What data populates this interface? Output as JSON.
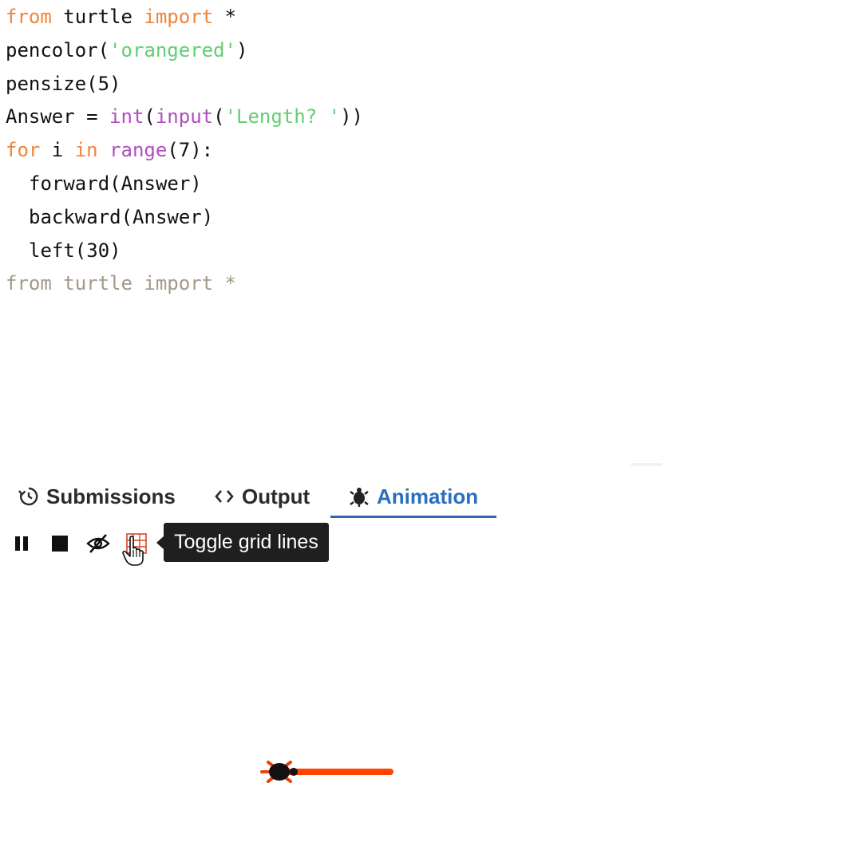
{
  "editor": {
    "lines": [
      [
        {
          "t": "from",
          "c": "kw"
        },
        {
          "t": " turtle ",
          "c": "plain"
        },
        {
          "t": "import",
          "c": "kw"
        },
        {
          "t": " *",
          "c": "plain"
        }
      ],
      [
        {
          "t": "pencolor(",
          "c": "plain"
        },
        {
          "t": "'orangered'",
          "c": "str"
        },
        {
          "t": ")",
          "c": "plain"
        }
      ],
      [
        {
          "t": "pensize(5)",
          "c": "plain"
        }
      ],
      [
        {
          "t": "Answer = ",
          "c": "plain"
        },
        {
          "t": "int",
          "c": "fn"
        },
        {
          "t": "(",
          "c": "plain"
        },
        {
          "t": "input",
          "c": "fn"
        },
        {
          "t": "(",
          "c": "plain"
        },
        {
          "t": "'Length? '",
          "c": "str"
        },
        {
          "t": "))",
          "c": "plain"
        }
      ],
      [
        {
          "t": "for",
          "c": "kw"
        },
        {
          "t": " i ",
          "c": "plain"
        },
        {
          "t": "in",
          "c": "kw"
        },
        {
          "t": " ",
          "c": "plain"
        },
        {
          "t": "range",
          "c": "fn"
        },
        {
          "t": "(7):",
          "c": "plain"
        }
      ],
      [
        {
          "t": "forward(Answer)",
          "c": "plain",
          "indent": true
        }
      ],
      [
        {
          "t": "backward(Answer)",
          "c": "plain",
          "indent": true
        }
      ],
      [
        {
          "t": "left(30)",
          "c": "plain",
          "indent": true
        }
      ],
      [
        {
          "t": "from turtle import *",
          "c": "ghost"
        }
      ]
    ]
  },
  "tabs": {
    "submissions": "Submissions",
    "output": "Output",
    "animation": "Animation",
    "active": "animation"
  },
  "toolbar": {
    "tooltip": "Toggle grid lines"
  },
  "colors": {
    "pen": "#ff4500",
    "accent": "#2a6fbd"
  },
  "icons": {
    "submissions": "history-icon",
    "output": "code-icon",
    "animation": "turtle-icon",
    "pause": "pause-icon",
    "stop": "stop-icon",
    "hide": "eye-off-icon",
    "grid": "grid-icon"
  }
}
